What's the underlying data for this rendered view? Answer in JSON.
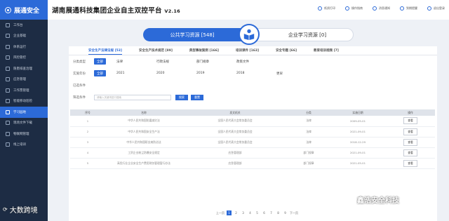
{
  "brand": {
    "name": "展通安全"
  },
  "sidebar": {
    "items": [
      {
        "label": "工作台",
        "active": false
      },
      {
        "label": "企业基础",
        "active": false
      },
      {
        "label": "体系运行",
        "active": false
      },
      {
        "label": "风险管控",
        "active": false
      },
      {
        "label": "隐患排查治理",
        "active": false
      },
      {
        "label": "应急管理",
        "active": false
      },
      {
        "label": "工作票管理",
        "active": false
      },
      {
        "label": "智能移动巡检",
        "active": false
      },
      {
        "label": "学习园地",
        "active": true
      },
      {
        "label": "现场文件下载",
        "active": false
      },
      {
        "label": "物联网管理",
        "active": false
      },
      {
        "label": "线上培训",
        "active": false
      }
    ]
  },
  "header": {
    "title": "湖南展通科技集团企业自主双控平台",
    "version": "V2.16",
    "actions": [
      "纸质打印",
      "操作指南",
      "消息通知",
      "到期提醒",
      "退出登录"
    ]
  },
  "resource_tabs": {
    "public": "公共学习资源 [548]",
    "enterprise": "企业学习资源 [0]"
  },
  "subtabs": [
    "安全生产法律法规 [53]",
    "安全生产技术规范 [89]",
    "典型事故案例 [166]",
    "培训课件 [163]",
    "安全专题 [66]",
    "教育培训视频 [7]"
  ],
  "filters": {
    "type_label": "分类类型",
    "type_selected": "全部",
    "type_options": [
      "法律",
      "行政法规",
      "部门规章",
      "政策文件"
    ],
    "year_label": "实施年份",
    "year_selected": "全部",
    "year_options": [
      "2021",
      "2020",
      "2019",
      "2018",
      "更早"
    ],
    "chosen_label": "已选条件",
    "search_label": "筛选条件",
    "search_placeholder": "请输入关键词进行搜索",
    "search_btn": "搜索",
    "reset_btn": "重置"
  },
  "table": {
    "headers": [
      "序号",
      "名称",
      "发文机关",
      "分类",
      "实施日期",
      "操作"
    ],
    "rows": [
      [
        "1",
        "中华人民共和国防震减灾法",
        "全国人民代表大会常务委员会",
        "法律",
        "2009-05-01",
        "查看"
      ],
      [
        "2",
        "中华人民共和国安全生产法",
        "全国人民代表大会常务委员会",
        "法律",
        "2021-09-01",
        "查看"
      ],
      [
        "3",
        "中华人民共和国职业病防治法",
        "全国人民代表大会常务委员会",
        "法律",
        "2018-12-29",
        "查看"
      ],
      [
        "4",
        "工贸企业粉尘防爆安全规定",
        "应急管理部",
        "部门规章",
        "2021-09-01",
        "查看"
      ],
      [
        "5",
        "高危行业企业安全生产费用财务管理暂行办法",
        "应急管理部",
        "部门规章",
        "2021-05-01",
        "查看"
      ]
    ]
  },
  "pager": {
    "prev": "上一页",
    "pages": [
      "1",
      "2",
      "3",
      "4",
      "5",
      "6",
      "7",
      "8",
      "9"
    ],
    "next": "下一页",
    "active": "1"
  },
  "watermarks": {
    "left": "大数跨境",
    "right": "鑫浩安全科技"
  }
}
